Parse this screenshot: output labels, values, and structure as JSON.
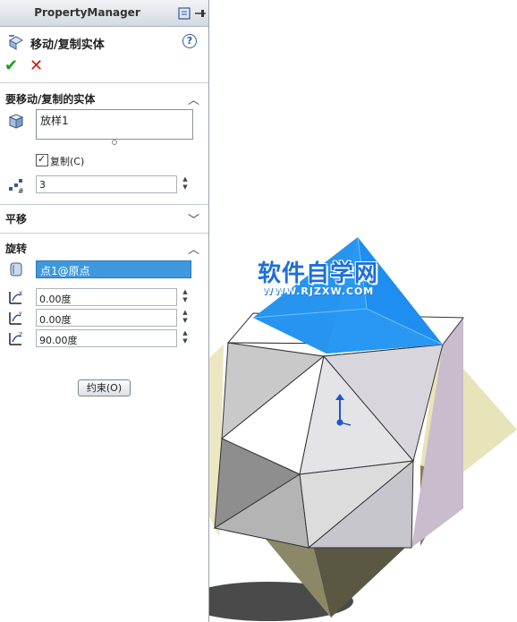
{
  "panel": {
    "header_title": "PropertyManager",
    "feature_title": "移动/复制实体",
    "help_glyph": "?",
    "ok_glyph": "✔",
    "cancel_glyph": "✕"
  },
  "bodies_section": {
    "title": "要移动/复制的实体",
    "selected_body": "放样1",
    "copy_checked": true,
    "copy_label": "复制(C)",
    "copy_count": "3"
  },
  "translate_section": {
    "title": "平移"
  },
  "rotate_section": {
    "title": "旋转",
    "rotation_point": "点1@原点",
    "angle_x": "0.00度",
    "angle_y": "0.00度",
    "angle_z": "90.00度"
  },
  "buttons": {
    "constraints": "约束(O)"
  },
  "watermark": {
    "title": "软件自学网",
    "url": "WWW.RJZXW.COM"
  },
  "colors": {
    "accent_blue": "#3e98e0",
    "pyramid_blue": "#1e8ef0",
    "annotation_red": "#e01818",
    "transparent_copy": "#d9d39a"
  }
}
